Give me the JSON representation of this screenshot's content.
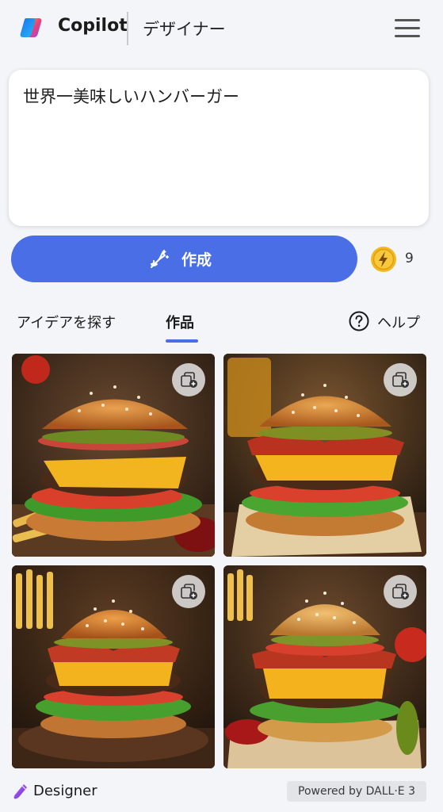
{
  "header": {
    "brand": "Copilot",
    "product": "デザイナー",
    "logo_icon": "copilot-logo",
    "menu_icon": "hamburger-menu-icon"
  },
  "prompt": {
    "text": "世界一美味しいハンバーガー"
  },
  "create": {
    "label": "作成",
    "icon": "wand-sparkle-icon",
    "accent": "#4a6ee6"
  },
  "boosts": {
    "icon": "lightning-coin-icon",
    "count": "9"
  },
  "tabs": [
    {
      "label": "アイデアを探す",
      "active": false
    },
    {
      "label": "作品",
      "active": true
    }
  ],
  "help": {
    "label": "ヘルプ",
    "icon": "question-circle-icon"
  },
  "images": [
    {
      "alt_icon": "burger-image",
      "save_icon": "save-to-collection-icon"
    },
    {
      "alt_icon": "burger-image",
      "save_icon": "save-to-collection-icon"
    },
    {
      "alt_icon": "burger-image",
      "save_icon": "save-to-collection-icon"
    },
    {
      "alt_icon": "burger-image",
      "save_icon": "save-to-collection-icon"
    }
  ],
  "footer": {
    "brand": "Designer",
    "powered": "Powered by DALL·E 3"
  }
}
